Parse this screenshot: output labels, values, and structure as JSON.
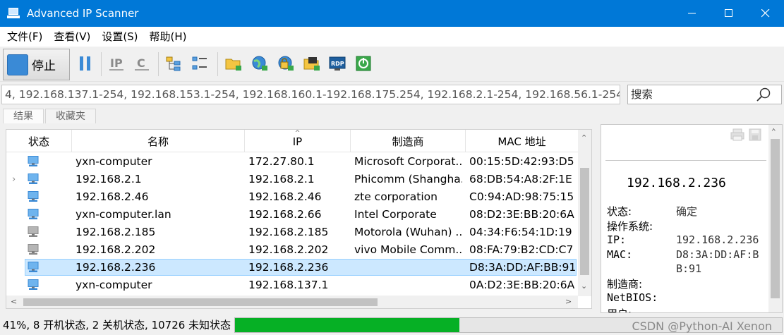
{
  "window": {
    "title": "Advanced IP Scanner"
  },
  "menu": [
    "文件(F)",
    "查看(V)",
    "设置(S)",
    "帮助(H)"
  ],
  "toolbar": {
    "stop_label": "停止"
  },
  "scan_range": "4, 192.168.137.1-254, 192.168.153.1-254, 192.168.160.1-192.168.175.254, 192.168.2.1-254, 192.168.56.1-254",
  "search": {
    "placeholder": "搜索"
  },
  "tabs": [
    "结果",
    "收藏夹"
  ],
  "columns": {
    "status": "状态",
    "name": "名称",
    "ip": "IP",
    "manufacturer": "制造商",
    "mac": "MAC 地址"
  },
  "rows": [
    {
      "name": "yxn-computer",
      "ip": "172.27.80.1",
      "manufacturer": "Microsoft Corporat...",
      "mac": "00:15:5D:42:93:D5",
      "status": "online"
    },
    {
      "name": "192.168.2.1",
      "ip": "192.168.2.1",
      "manufacturer": "Phicomm (Shangha...",
      "mac": "68:DB:54:A8:2F:1E",
      "status": "online"
    },
    {
      "name": "192.168.2.46",
      "ip": "192.168.2.46",
      "manufacturer": "zte corporation",
      "mac": "C0:94:AD:98:75:15",
      "status": "online"
    },
    {
      "name": "yxn-computer.lan",
      "ip": "192.168.2.66",
      "manufacturer": "Intel Corporate",
      "mac": "08:D2:3E:BB:20:6A",
      "status": "online"
    },
    {
      "name": "192.168.2.185",
      "ip": "192.168.2.185",
      "manufacturer": "Motorola (Wuhan) ...",
      "mac": "04:34:F6:54:1D:19",
      "status": "offline"
    },
    {
      "name": "192.168.2.202",
      "ip": "192.168.2.202",
      "manufacturer": "vivo Mobile Comm...",
      "mac": "08:FA:79:B2:CD:C7",
      "status": "offline"
    },
    {
      "name": "192.168.2.236",
      "ip": "192.168.2.236",
      "manufacturer": "",
      "mac": "D8:3A:DD:AF:BB:91",
      "status": "online"
    },
    {
      "name": "yxn-computer",
      "ip": "192.168.137.1",
      "manufacturer": "",
      "mac": "0A:D2:3E:BB:20:6A",
      "status": "online"
    }
  ],
  "details": {
    "ip_heading": "192.168.2.236",
    "status_label": "状态:",
    "status_value": "确定",
    "os_label": "操作系统:",
    "ip_label": "IP:",
    "ip_value": "192.168.2.236",
    "mac_label": "MAC:",
    "mac_value": "D8:3A:DD:AF:BB:91",
    "manufacturer_label": "制造商:",
    "netbios_label": "NetBIOS:",
    "user_label": "用户:"
  },
  "statusbar": {
    "text": "41%, 8 开机状态, 2 关机状态, 10726 未知状态",
    "progress": 0.41,
    "watermark": "CSDN @Python-AI Xenon"
  },
  "colors": {
    "titlebar": "#0078d7",
    "progress": "#06b025",
    "selection": "#cce8ff"
  }
}
